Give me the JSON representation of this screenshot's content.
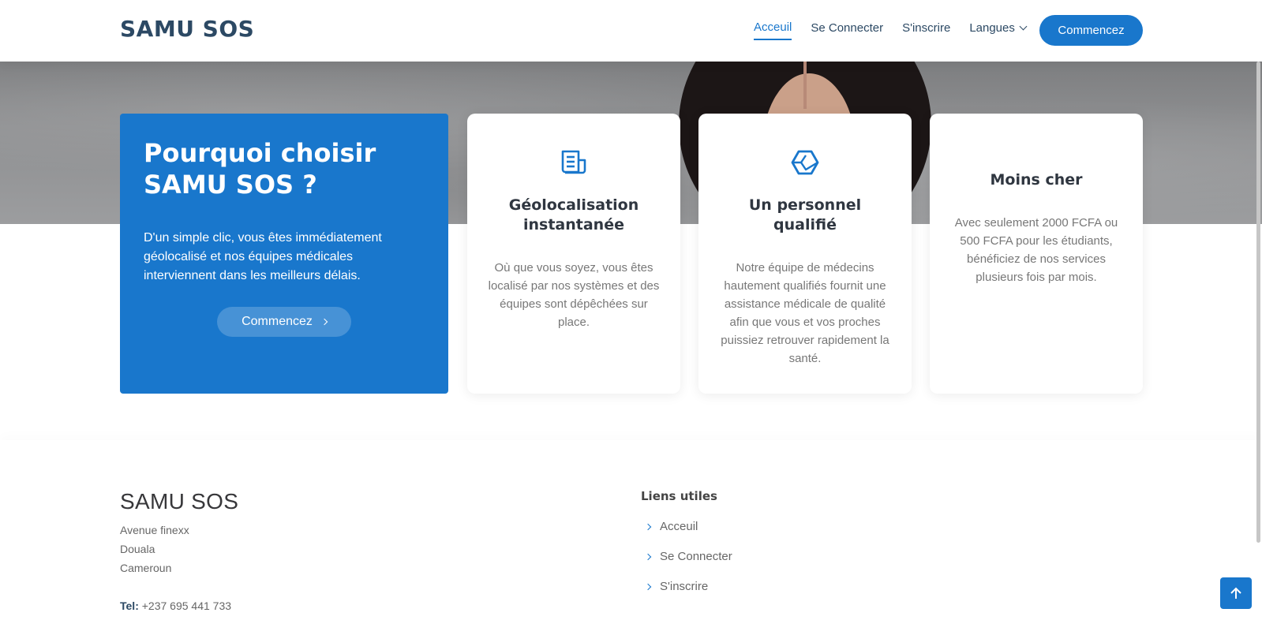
{
  "header": {
    "logo": "SAMU SOS",
    "nav": [
      {
        "label": "Acceuil",
        "active": true
      },
      {
        "label": "Se Connecter",
        "active": false
      },
      {
        "label": "S'inscrire",
        "active": false
      },
      {
        "label": "Langues",
        "active": false,
        "dropdown": true
      }
    ],
    "cta_label": "Commencez"
  },
  "why": {
    "title": "Pourquoi choisir SAMU SOS ?",
    "text": "D'un simple clic, vous êtes immédiatement géolocalisé et nos équipes médicales interviennent dans les meilleurs délais.",
    "button_label": "Commencez"
  },
  "cards": [
    {
      "icon": "document-icon",
      "title": "Géolocalisation instantanée",
      "text": "Où que vous soyez, vous êtes localisé par nos systèmes et des équipes sont dépêchées sur place."
    },
    {
      "icon": "hexagon-icon",
      "title": "Un personnel qualifié",
      "text": "Notre équipe de médecins hautement qualifiés fournit une assistance médicale de qualité afin que vous et vos proches puissiez retrouver rapidement la santé."
    },
    {
      "icon": "",
      "title": "Moins cher",
      "text": "Avec seulement 2000 FCFA ou 500 FCFA pour les étudiants, bénéficiez de nos services plusieurs fois par mois."
    }
  ],
  "footer": {
    "title": "SAMU SOS",
    "address": [
      "Avenue finexx",
      "Douala",
      "Cameroun"
    ],
    "tel_label": "Tel:",
    "tel": "+237 695 441 733",
    "links_title": "Liens utiles",
    "links": [
      "Acceuil",
      "Se Connecter",
      "S'inscrire"
    ]
  },
  "colors": {
    "accent": "#1977cc",
    "heading": "#2c4964"
  }
}
